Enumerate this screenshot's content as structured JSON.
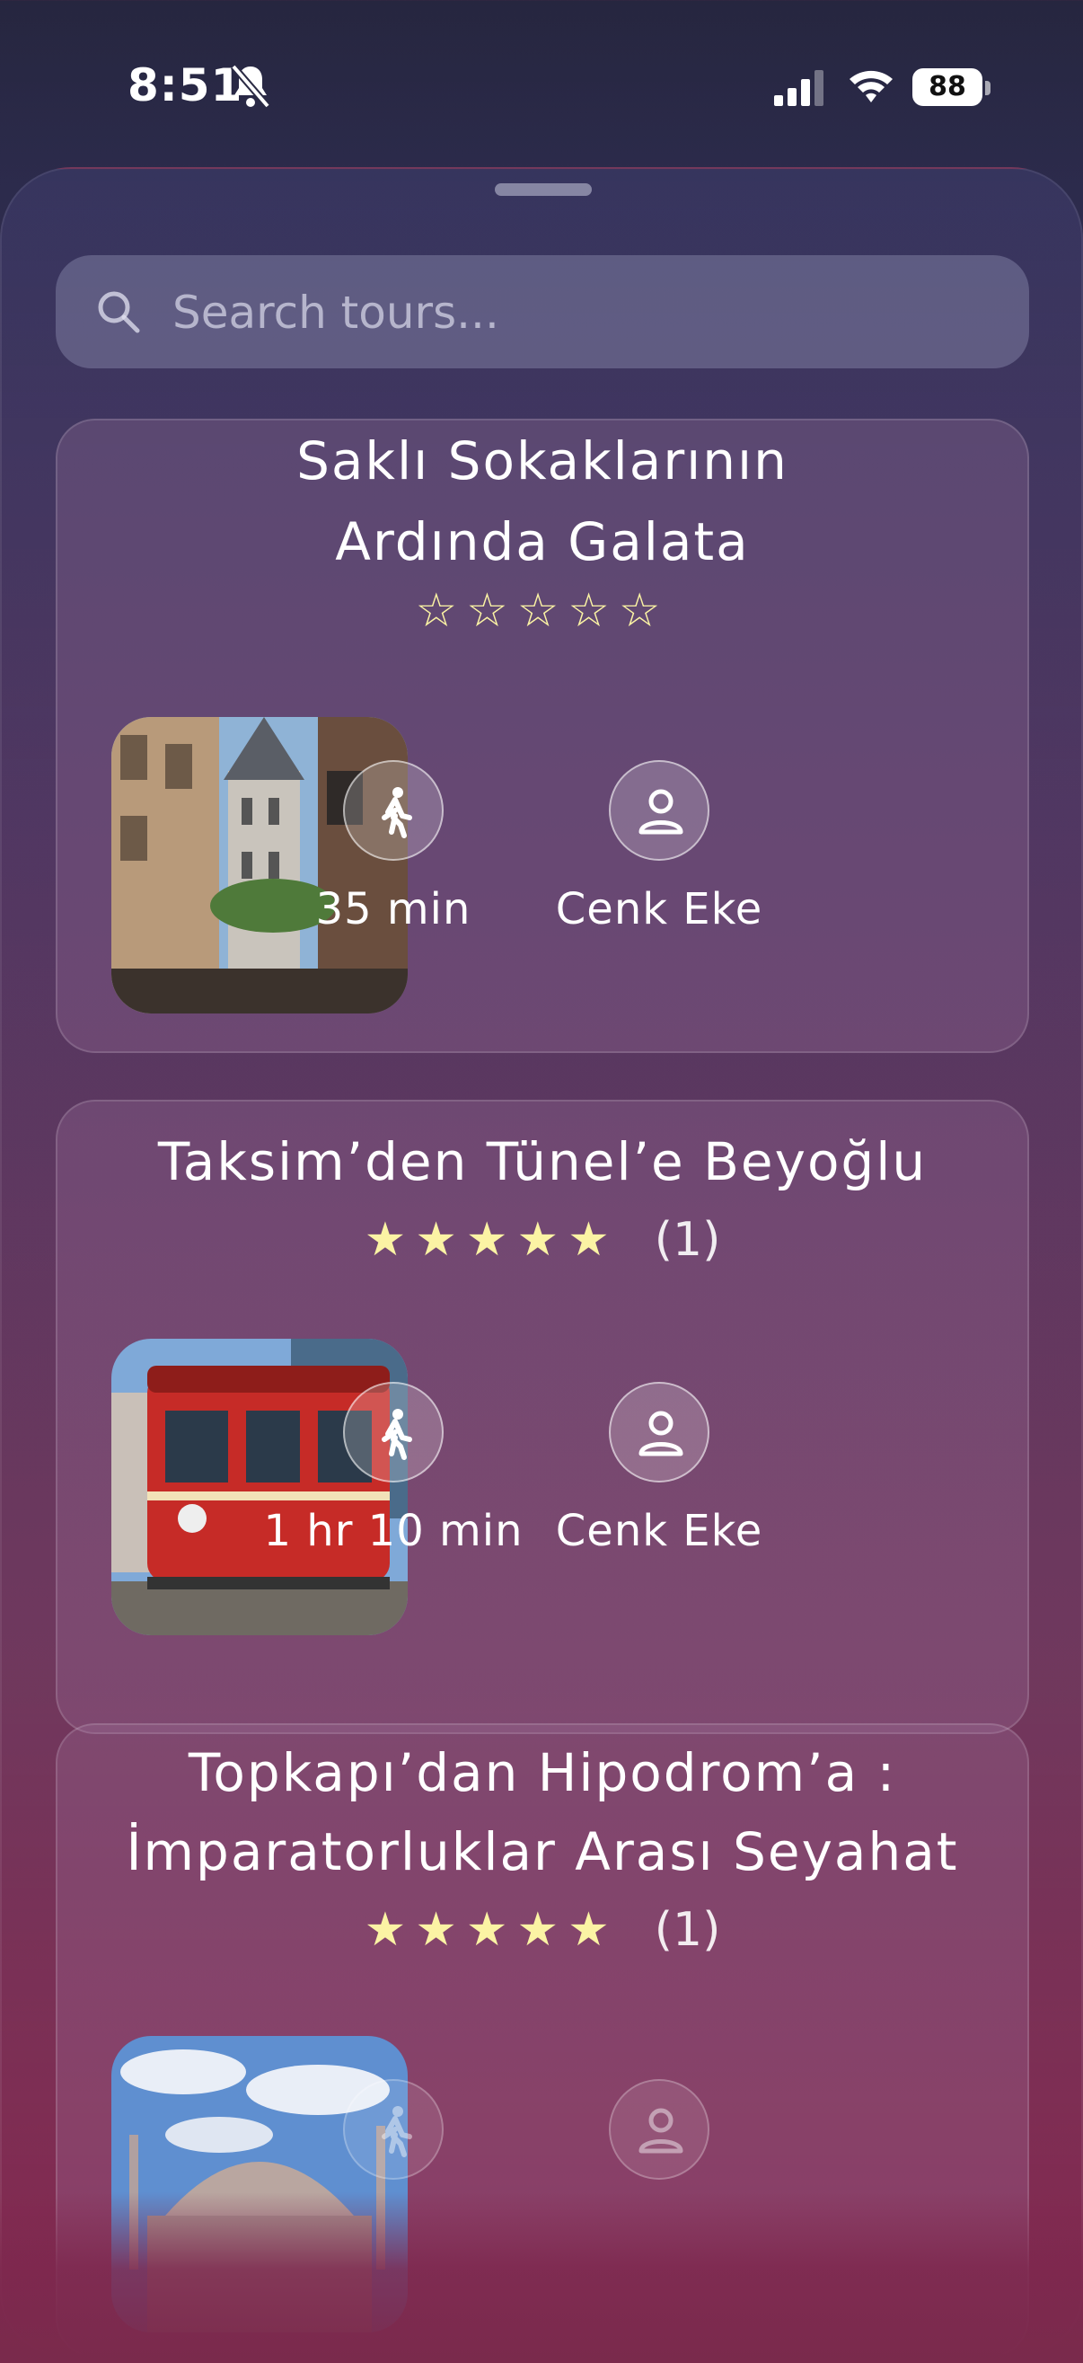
{
  "status_bar": {
    "time": "8:51",
    "battery": "88"
  },
  "search": {
    "placeholder": "Search tours..."
  },
  "tours": [
    {
      "title_line1": "Saklı Sokaklarının",
      "title_line2": "Ardında Galata",
      "stars": "☆☆☆☆☆",
      "rating_count": "",
      "duration": "35 min",
      "guide": "Cenk Eke"
    },
    {
      "title_line1": "Taksim’den Tünel’e Beyoğlu",
      "title_line2": "",
      "stars": "★★★★★",
      "rating_count": "(1)",
      "duration": "1 hr 10 min",
      "guide": "Cenk Eke"
    },
    {
      "title_line1": "Topkapı’dan Hipodrom’a :",
      "title_line2": "İmparatorluklar Arası Seyahat",
      "stars": "★★★★★",
      "rating_count": "(1)",
      "duration": "",
      "guide": ""
    }
  ],
  "colors": {
    "star": "#fbf3a4",
    "accent_bg": "#4a3158"
  },
  "icons": {
    "walk": "walking-person-icon",
    "guide": "person-icon",
    "search": "search-icon"
  }
}
